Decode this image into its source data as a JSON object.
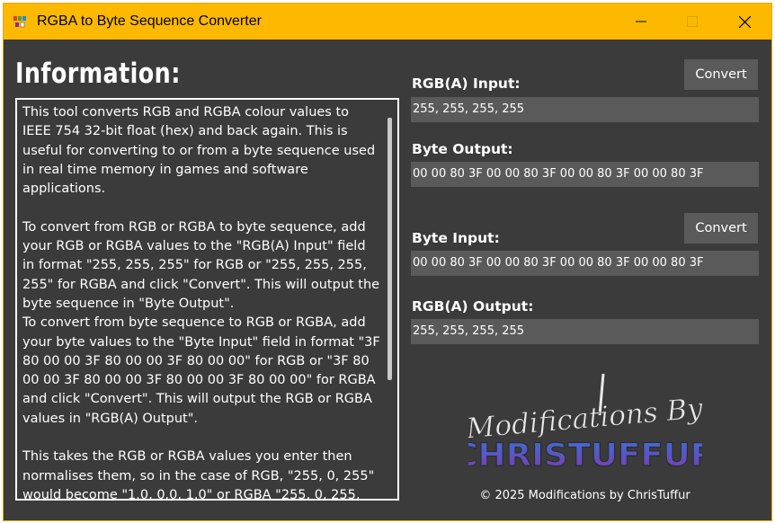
{
  "window": {
    "title": "RGBA to Byte Sequence Converter",
    "accent_color": "#fdb900",
    "background_color": "#3b3b3b",
    "controls": [
      "minimize-icon",
      "maximize-icon",
      "close-icon"
    ]
  },
  "info": {
    "heading": "Information:",
    "text": "This tool converts RGB and RGBA colour values to IEEE 754 32-bit float (hex) and back again. This is useful for converting to or from a byte sequence used in real time memory in games and software applications.\n\nTo convert from RGB or RGBA to byte sequence, add your RGB or RGBA values to the \"RGB(A) Input\" field in format \"255, 255, 255\" for RGB or \"255, 255, 255, 255\" for RGBA and click \"Convert\". This will output the byte sequence in \"Byte Output\".\nTo convert from byte sequence to RGB or RGBA, add your byte values to the \"Byte Input\" field in format \"3F 80 00 00 3F 80 00 00 3F 80 00 00\" for RGB or \"3F 80 00 00 3F 80 00 00 3F 80 00 00 3F 80 00 00\" for RGBA and click \"Convert\". This will output the RGB or RGBA values in \"RGB(A) Output\".\n\nThis takes the RGB or RGBA values you enter then normalises them, so in the case of RGB, \"255, 0, 255\" would become \"1.0, 0.0, 1.0\" or RGBA \"255, 0, 255,"
  },
  "rgb_to_bytes": {
    "input_label": "RGB(A) Input:",
    "input_value": "255, 255, 255, 255",
    "output_label": "Byte Output:",
    "output_value": "00 00 80 3F 00 00 80 3F 00 00 80 3F 00 00 80 3F",
    "convert_label": "Convert"
  },
  "bytes_to_rgb": {
    "input_label": "Byte Input:",
    "input_value": "00 00 80 3F 00 00 80 3F 00 00 80 3F 00 00 80 3F",
    "output_label": "RGB(A) Output:",
    "output_value": "255, 255, 255, 255",
    "convert_label": "Convert"
  },
  "logo": {
    "line1": "Modifications By",
    "line2": "CHRISTUFFUR"
  },
  "footer": {
    "copyright": "© 2025 Modifications by ChrisTuffur"
  }
}
